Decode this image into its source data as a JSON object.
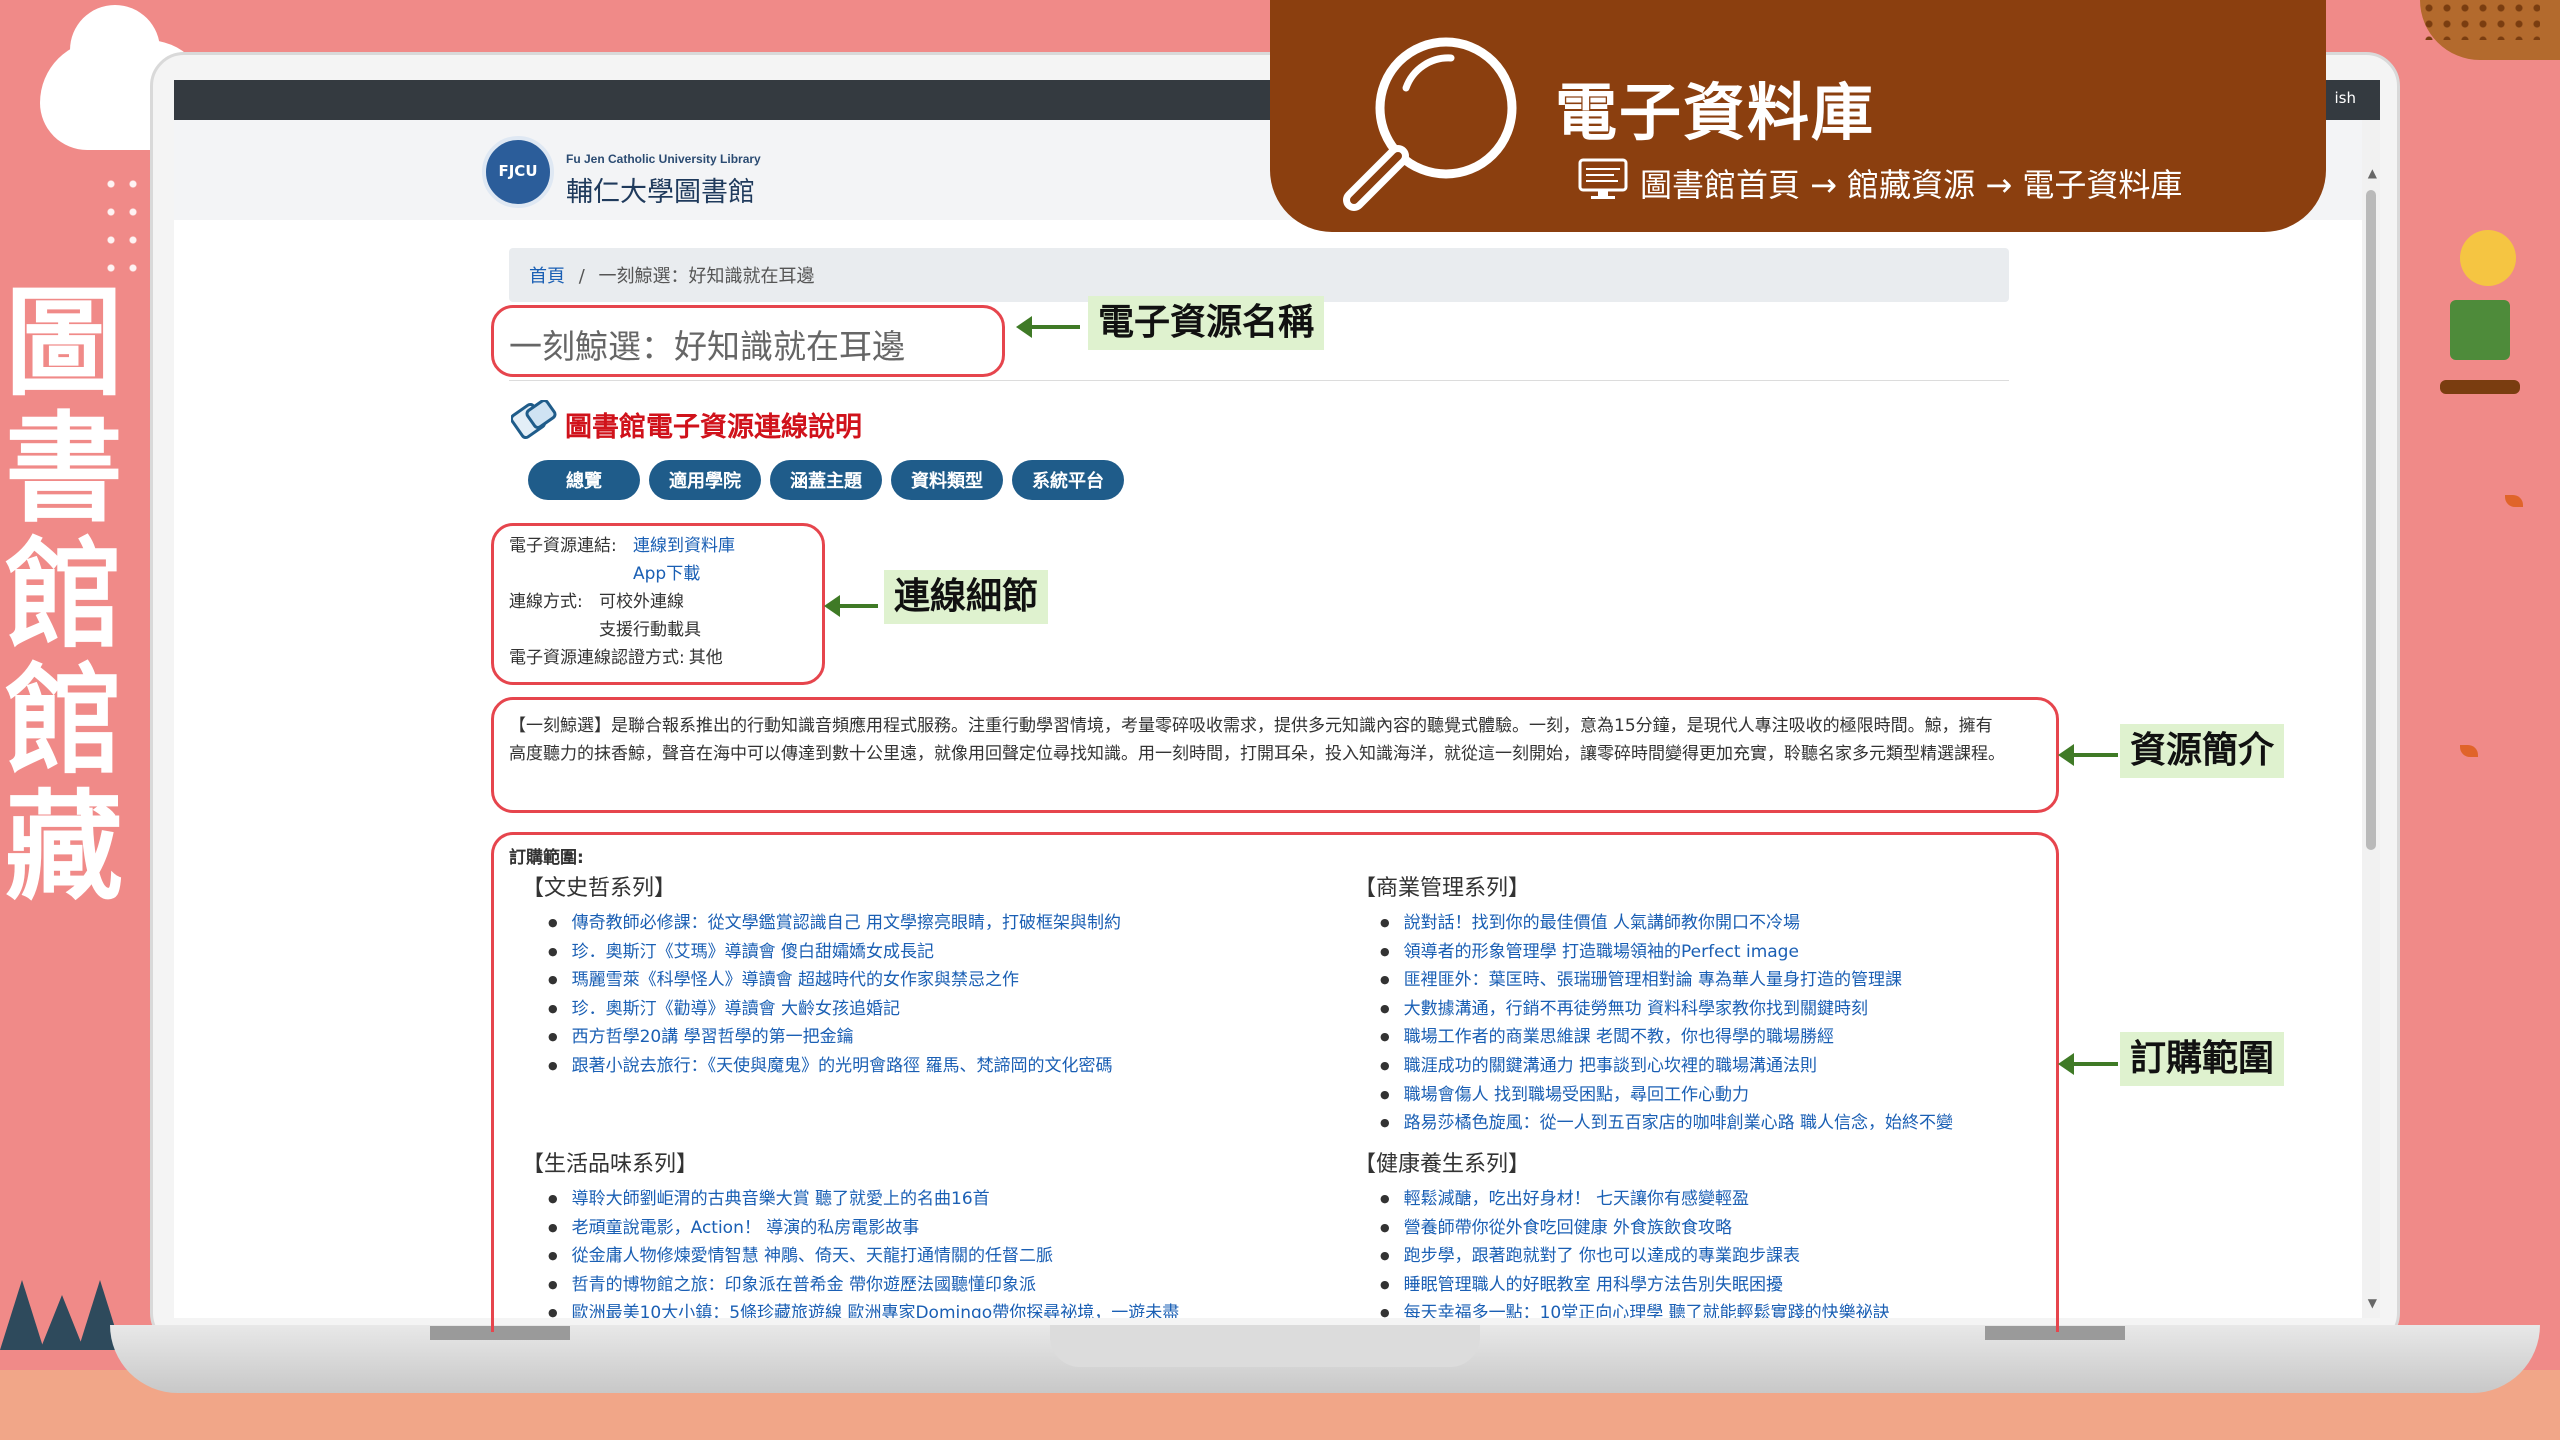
{
  "side_title": [
    "圖",
    "書",
    "館",
    "館",
    "藏"
  ],
  "banner": {
    "title": "電子資料庫",
    "path": "圖書館首頁 → 館藏資源 → 電子資料庫"
  },
  "screen": {
    "topbar_lang": "ish",
    "logo_seal": "FJCU",
    "logo_en": "Fu Jen Catholic University Library",
    "logo_zh": "輔仁大學圖書館",
    "breadcrumb": {
      "home": "首頁",
      "sep": "/",
      "current": "一刻鯨選：好知識就在耳邊"
    },
    "page_title": "一刻鯨選：好知識就在耳邊",
    "connection_title": "圖書館電子資源連線說明",
    "pills": [
      "總覽",
      "適用學院",
      "涵蓋主題",
      "資料類型",
      "系統平台"
    ],
    "info": {
      "link_label": "電子資源連結:",
      "link_value_1": "連線到資料庫",
      "link_value_2": "App下載",
      "mode_label": "連線方式:",
      "mode_value_1": "可校外連線",
      "mode_value_2": "支援行動載具",
      "auth_label": "電子資源連線認證方式:",
      "auth_value": "其他"
    },
    "intro": "【一刻鯨選】是聯合報系推出的行動知識音頻應用程式服務。注重行動學習情境，考量零碎吸收需求，提供多元知識內容的聽覺式體驗。一刻，意為15分鐘，是現代人專注吸收的極限時間。鯨，擁有高度聽力的抹香鯨，聲音在海中可以傳達到數十公里遠，就像用回聲定位尋找知識。用一刻時間，打開耳朵，投入知識海洋，就從這一刻開始，讓零碎時間變得更加充實，聆聽名家多元類型精選課程。",
    "subscription_label": "訂購範圍:",
    "series": [
      {
        "title": "【文史哲系列】",
        "items": [
          "傳奇教師必修課：從文學鑑賞認識自己 用文學擦亮眼睛，打破框架與制約",
          "珍．奧斯汀《艾瑪》導讀會 傻白甜孀嬌女成長記",
          "瑪麗雪萊《科學怪人》導讀會 超越時代的女作家與禁忌之作",
          "珍．奧斯汀《勸導》導讀會 大齡女孩追婚記",
          "西方哲學20講 學習哲學的第一把金鑰",
          "跟著小說去旅行：《天使與魔鬼》的光明會路徑 羅馬、梵諦岡的文化密碼"
        ]
      },
      {
        "title": "【商業管理系列】",
        "items": [
          "說對話！找到你的最佳價值 人氣講師教你開口不冷場",
          "領導者的形象管理學 打造職場領袖的Perfect image",
          "匪裡匪外：葉匡時、張瑞珊管理相對論 專為華人量身打造的管理課",
          "大數據溝通，行銷不再徒勞無功 資料科學家教你找到關鍵時刻",
          "職場工作者的商業思維課 老闆不教，你也得學的職場勝經",
          "職涯成功的關鍵溝通力 把事談到心坎裡的職場溝通法則",
          "職場會傷人 找到職場受困點，尋回工作心動力",
          "路易莎橘色旋風：從一人到五百家店的咖啡創業心路 職人信念，始終不變"
        ]
      },
      {
        "title": "【生活品味系列】",
        "items": [
          "導聆大師劉岠渭的古典音樂大賞 聽了就愛上的名曲16首",
          "老頑童說電影，Action！ 導演的私房電影故事",
          "從金庸人物修煉愛情智慧 神鵰、倚天、天龍打通情關的任督二脈",
          "哲青的博物館之旅：印象派在普希金 帶你遊歷法國聽懂印象派",
          "歐洲最美10大小鎮：5條珍藏旅遊線 歐洲專家Domingo帶你探尋祕境，一遊未盡"
        ]
      },
      {
        "title": "【健康養生系列】",
        "items": [
          "輕鬆減醣，吃出好身材！ 七天讓你有感變輕盈",
          "營養師帶你從外食吃回健康 外食族飲食攻略",
          "跑步學，跟著跑就對了 你也可以達成的專業跑步課表",
          "睡眠管理職人的好眠教室 用科學方法告別失眠困擾",
          "每天幸福多一點：10堂正向心理學 聽了就能輕鬆實踐的快樂祕訣"
        ]
      }
    ]
  },
  "callouts": {
    "resource_name": "電子資源名稱",
    "connection_details": "連線細節",
    "resource_intro": "資源簡介",
    "subscription_scope": "訂購範圍"
  },
  "colors": {
    "background": "#f08a88",
    "banner": "#8b3f0f",
    "annotation_box": "#e6454d",
    "annotation_label_bg": "#dff2cf",
    "arrow": "#3f7a26",
    "pill": "#1f5c8a",
    "link": "#1a5fb4",
    "connection_title": "#d0121b"
  },
  "icons": {
    "banner": "magnifier-icon",
    "path": "monitor-icon",
    "connection": "connection-icon"
  }
}
